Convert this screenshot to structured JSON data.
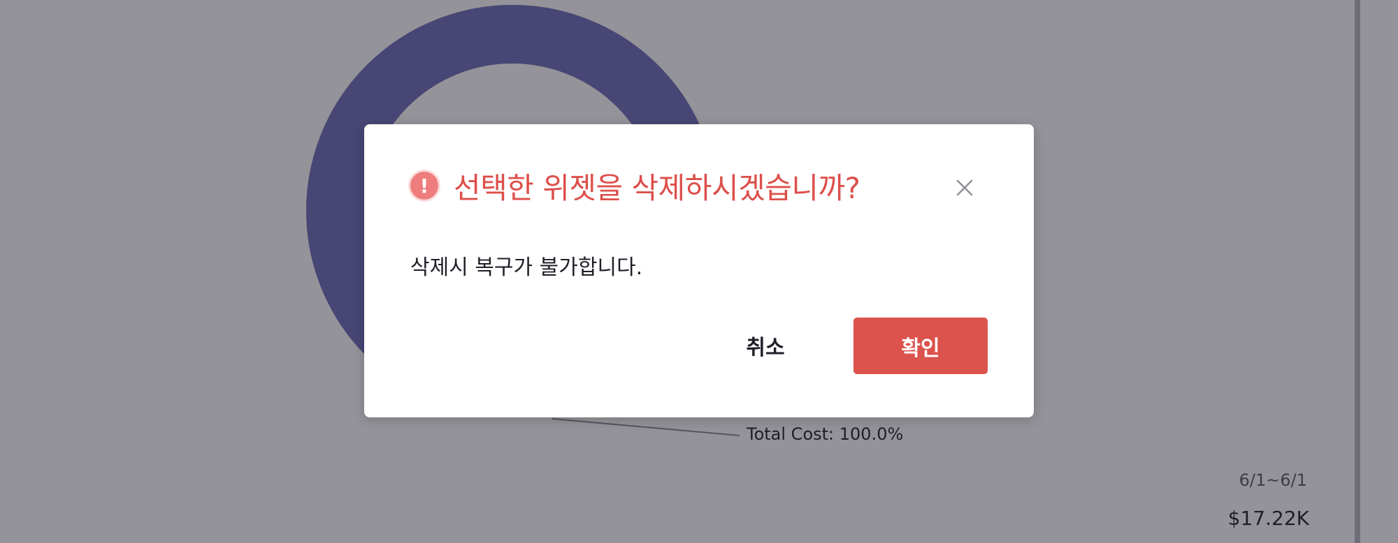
{
  "background_widget": {
    "donut_label": "Total Cost: 100.0%",
    "date_range": "6/1~6/1",
    "total_value": "$17.22K",
    "donut_color": "#6f6cb8"
  },
  "dialog": {
    "title": "선택한 위젯을 삭제하시겠습니까?",
    "message": "삭제시 복구가 불가합니다.",
    "cancel_label": "취소",
    "confirm_label": "확인",
    "warning_icon": "exclamation-circle-icon",
    "close_icon": "close-icon",
    "accent_color": "#dc524d"
  }
}
